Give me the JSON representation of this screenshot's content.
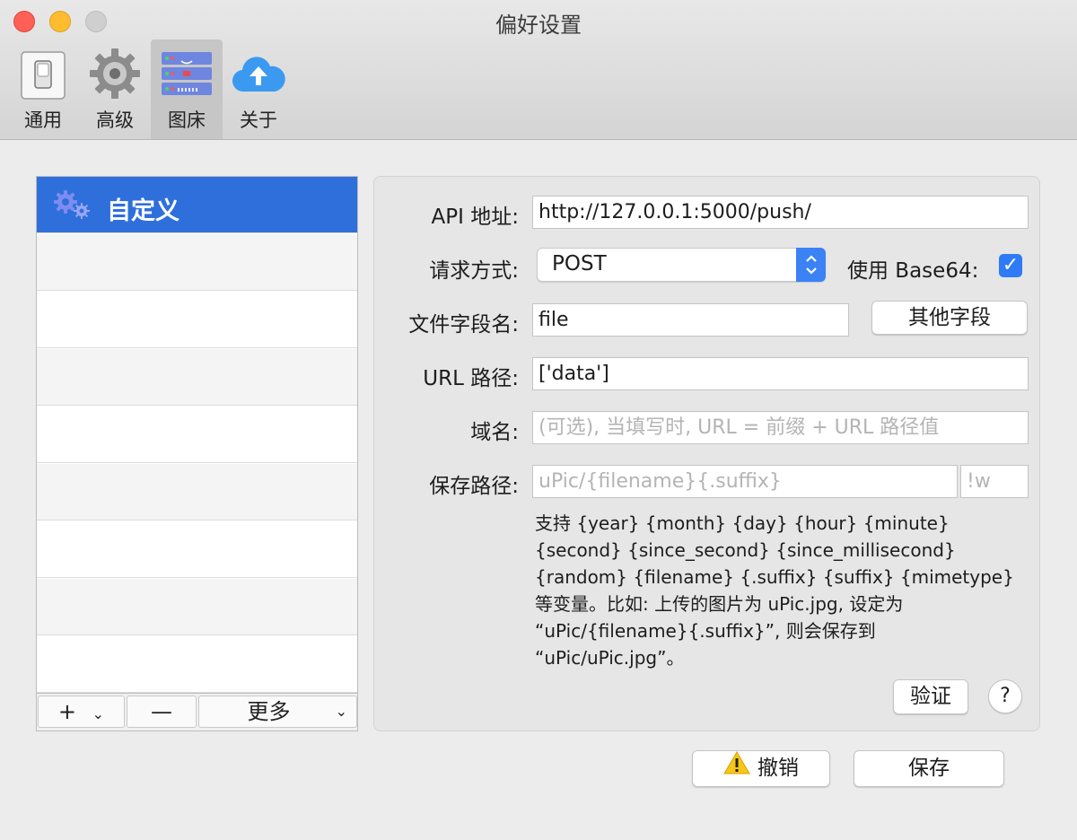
{
  "window": {
    "title": "偏好设置"
  },
  "toolbar": {
    "items": [
      {
        "label": "通用",
        "icon": "switch-icon"
      },
      {
        "label": "高级",
        "icon": "gear-icon"
      },
      {
        "label": "图床",
        "icon": "server-icon",
        "active": true
      },
      {
        "label": "关于",
        "icon": "cloud-upload-icon"
      }
    ]
  },
  "hosts": {
    "items": [
      {
        "label": "自定义",
        "selected": true,
        "icon": "gears-icon"
      }
    ],
    "footer": {
      "add": "+",
      "remove": "—",
      "more": "更多"
    }
  },
  "form": {
    "api_label": "API 地址:",
    "api_value": "http://127.0.0.1:5000/push/",
    "method_label": "请求方式:",
    "method_value": "POST",
    "base64_label": "使用 Base64:",
    "base64_checked": true,
    "file_field_label": "文件字段名:",
    "file_field_value": "file",
    "other_fields_button": "其他字段",
    "url_path_label": "URL 路径:",
    "url_path_value": "['data']",
    "domain_label": "域名:",
    "domain_placeholder": "(可选), 当填写时, URL = 前缀 + URL 路径值",
    "save_path_label": "保存路径:",
    "save_path_placeholder": "uPic/{filename}{.suffix}",
    "suffix_placeholder": "!w",
    "help_text": "支持 {year} {month} {day} {hour} {minute} {second} {since_second} {since_millisecond} {random} {filename} {.suffix} {suffix} {mimetype} 等变量。比如: 上传的图片为 uPic.jpg, 设定为 “uPic/{filename}{.suffix}”, 则会保存到 “uPic/uPic.jpg”。",
    "verify_button": "验证",
    "help_button": "?"
  },
  "actions": {
    "revert": "撤销",
    "save": "保存"
  },
  "colors": {
    "accent": "#2f6fdc",
    "checkbox": "#2f7bf5"
  }
}
